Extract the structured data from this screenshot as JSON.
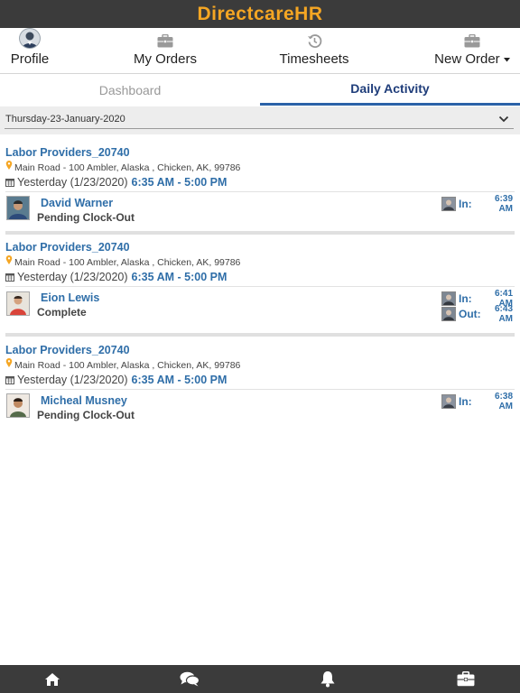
{
  "app": {
    "title": "DirectcareHR"
  },
  "nav": {
    "profile": "Profile",
    "orders": "My Orders",
    "timesheets": "Timesheets",
    "new_order": "New Order"
  },
  "tabs": {
    "dashboard": "Dashboard",
    "daily": "Daily Activity"
  },
  "date_filter": {
    "value": "Thursday-23-January-2020"
  },
  "entries": [
    {
      "provider": "Labor Providers_20740",
      "address": "Main Road - 100 Ambler, Alaska , Chicken, AK, 99786",
      "day": "Yesterday (1/23/2020)",
      "hours": "6:35 AM - 5:00 PM",
      "name": "David Warner",
      "status": "Pending Clock-Out",
      "in_label": "In:",
      "in_time": "6:39 AM"
    },
    {
      "provider": "Labor Providers_20740",
      "address": "Main Road - 100 Ambler, Alaska , Chicken, AK, 99786",
      "day": "Yesterday (1/23/2020)",
      "hours": "6:35 AM - 5:00 PM",
      "name": "Eion Lewis",
      "status": "Complete",
      "in_label": "In:",
      "in_time": "6:41 AM",
      "out_label": "Out:",
      "out_time": "6:43 AM"
    },
    {
      "provider": "Labor Providers_20740",
      "address": "Main Road - 100 Ambler, Alaska , Chicken, AK, 99786",
      "day": "Yesterday (1/23/2020)",
      "hours": "6:35 AM - 5:00 PM",
      "name": "Micheal Musney",
      "status": "Pending Clock-Out",
      "in_label": "In:",
      "in_time": "6:38 AM"
    }
  ],
  "bottom_nav": [
    "home-icon",
    "chat-icon",
    "bell-icon",
    "briefcase-icon"
  ],
  "colors": {
    "brand": "#f5a623",
    "bar": "#3b3b3b",
    "link": "#2f6ea8",
    "tab_active": "#1f3d7a"
  }
}
